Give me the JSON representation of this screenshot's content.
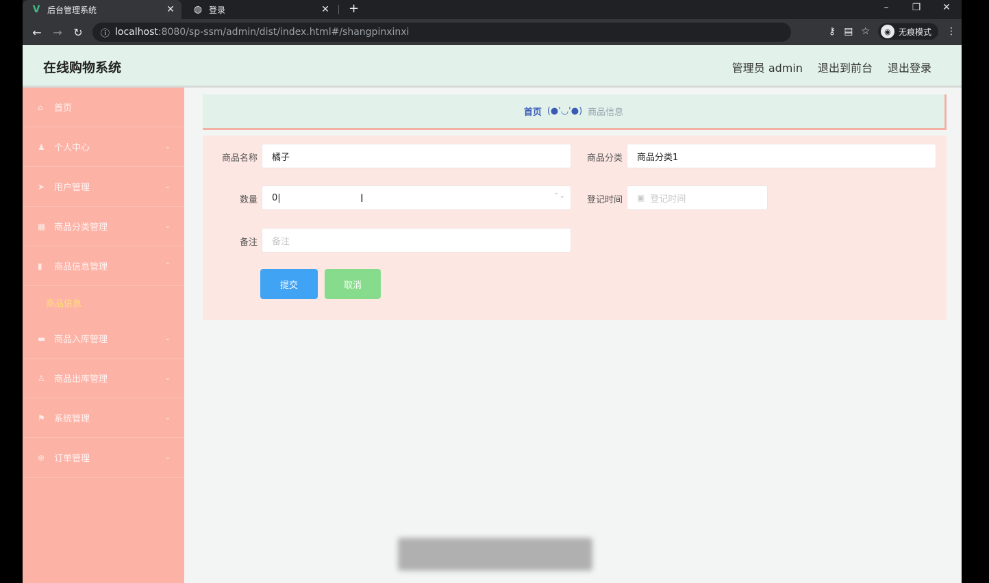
{
  "browser": {
    "tabs": [
      {
        "title": "后台管理系统",
        "favicon": "vue-logo-icon",
        "active": true
      },
      {
        "title": "登录",
        "favicon": "globe-icon",
        "active": false
      }
    ],
    "url_host": "localhost",
    "url_path": ":8080/sp-ssm/admin/dist/index.html#/shangpinxinxi",
    "incognito_label": "无痕模式",
    "close_glyph": "✕",
    "newtab_glyph": "+"
  },
  "header": {
    "brand": "在线购物系统",
    "links": [
      "管理员 admin",
      "退出到前台",
      "退出登录"
    ]
  },
  "sidebar": {
    "items": [
      {
        "label": "首页",
        "icon": "home-icon",
        "arrow": false
      },
      {
        "label": "个人中心",
        "icon": "user-icon",
        "arrow": true
      },
      {
        "label": "用户管理",
        "icon": "send-icon",
        "arrow": true
      },
      {
        "label": "商品分类管理",
        "icon": "grid-icon",
        "arrow": true
      },
      {
        "label": "商品信息管理",
        "icon": "book-icon",
        "arrow": true
      },
      {
        "label": "商品信息",
        "icon": "",
        "arrow": false,
        "sub": true
      },
      {
        "label": "商品入库管理",
        "icon": "box-icon",
        "arrow": true
      },
      {
        "label": "商品出库管理",
        "icon": "person-icon",
        "arrow": true
      },
      {
        "label": "系统管理",
        "icon": "flag-icon",
        "arrow": true
      },
      {
        "label": "订单管理",
        "icon": "cart-icon",
        "arrow": true
      }
    ]
  },
  "breadcrumb": {
    "home": "首页",
    "separator": "(●'◡'●)",
    "current": "商品信息"
  },
  "form": {
    "name_label": "商品名称",
    "name_value": "橘子",
    "category_label": "商品分类",
    "category_value": "商品分类1",
    "qty_label": "数量",
    "qty_value": "0",
    "date_label": "登记时间",
    "date_placeholder": "登记时间",
    "remark_label": "备注",
    "remark_placeholder": "备注",
    "submit_label": "提交",
    "cancel_label": "取消"
  }
}
